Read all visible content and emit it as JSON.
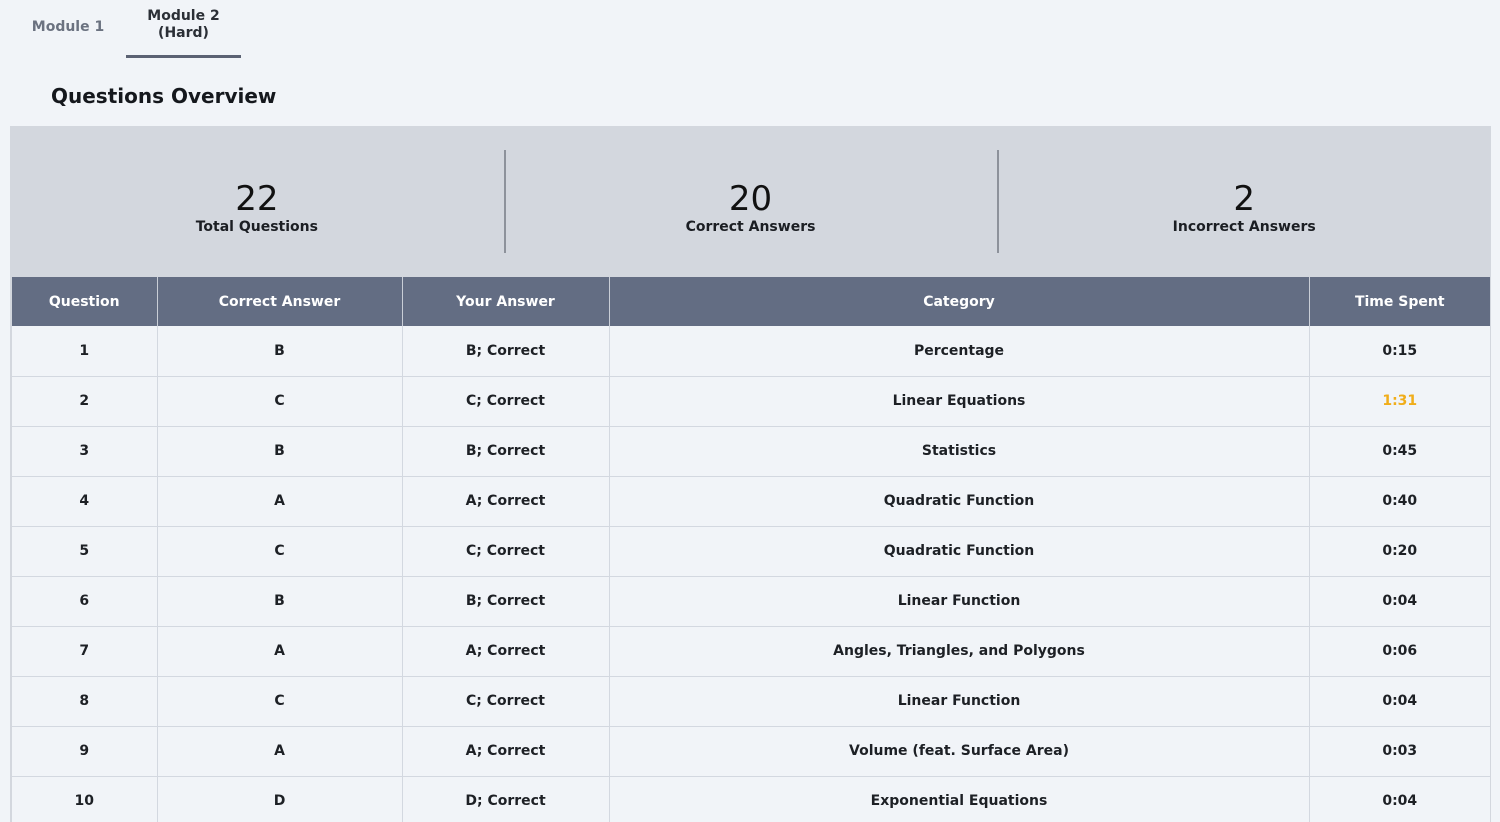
{
  "tabs": [
    {
      "label": "Module 1",
      "active": false
    },
    {
      "label": "Module 2\n(Hard)",
      "active": true
    }
  ],
  "section_title": "Questions Overview",
  "summary": [
    {
      "value": "22",
      "label": "Total Questions"
    },
    {
      "value": "20",
      "label": "Correct Answers"
    },
    {
      "value": "2",
      "label": "Incorrect Answers"
    }
  ],
  "table": {
    "headers": [
      "Question",
      "Correct Answer",
      "Your Answer",
      "Category",
      "Time Spent"
    ],
    "rows": [
      {
        "question": "1",
        "correct": "B",
        "yours": "B; Correct",
        "category": "Percentage",
        "time": "0:15",
        "slow": false
      },
      {
        "question": "2",
        "correct": "C",
        "yours": "C; Correct",
        "category": "Linear Equations",
        "time": "1:31",
        "slow": true
      },
      {
        "question": "3",
        "correct": "B",
        "yours": "B; Correct",
        "category": "Statistics",
        "time": "0:45",
        "slow": false
      },
      {
        "question": "4",
        "correct": "A",
        "yours": "A; Correct",
        "category": "Quadratic Function",
        "time": "0:40",
        "slow": false
      },
      {
        "question": "5",
        "correct": "C",
        "yours": "C; Correct",
        "category": "Quadratic Function",
        "time": "0:20",
        "slow": false
      },
      {
        "question": "6",
        "correct": "B",
        "yours": "B; Correct",
        "category": "Linear Function",
        "time": "0:04",
        "slow": false
      },
      {
        "question": "7",
        "correct": "A",
        "yours": "A; Correct",
        "category": "Angles, Triangles, and Polygons",
        "time": "0:06",
        "slow": false
      },
      {
        "question": "8",
        "correct": "C",
        "yours": "C; Correct",
        "category": "Linear Function",
        "time": "0:04",
        "slow": false
      },
      {
        "question": "9",
        "correct": "A",
        "yours": "A; Correct",
        "category": "Volume (feat. Surface Area)",
        "time": "0:03",
        "slow": false
      },
      {
        "question": "10",
        "correct": "D",
        "yours": "D; Correct",
        "category": "Exponential Equations",
        "time": "0:04",
        "slow": false
      }
    ]
  },
  "colors": {
    "header_bg": "#636d83",
    "summary_bg": "#d3d7de",
    "slow_time": "#f0ad1a",
    "page_bg": "#f1f4f8"
  }
}
